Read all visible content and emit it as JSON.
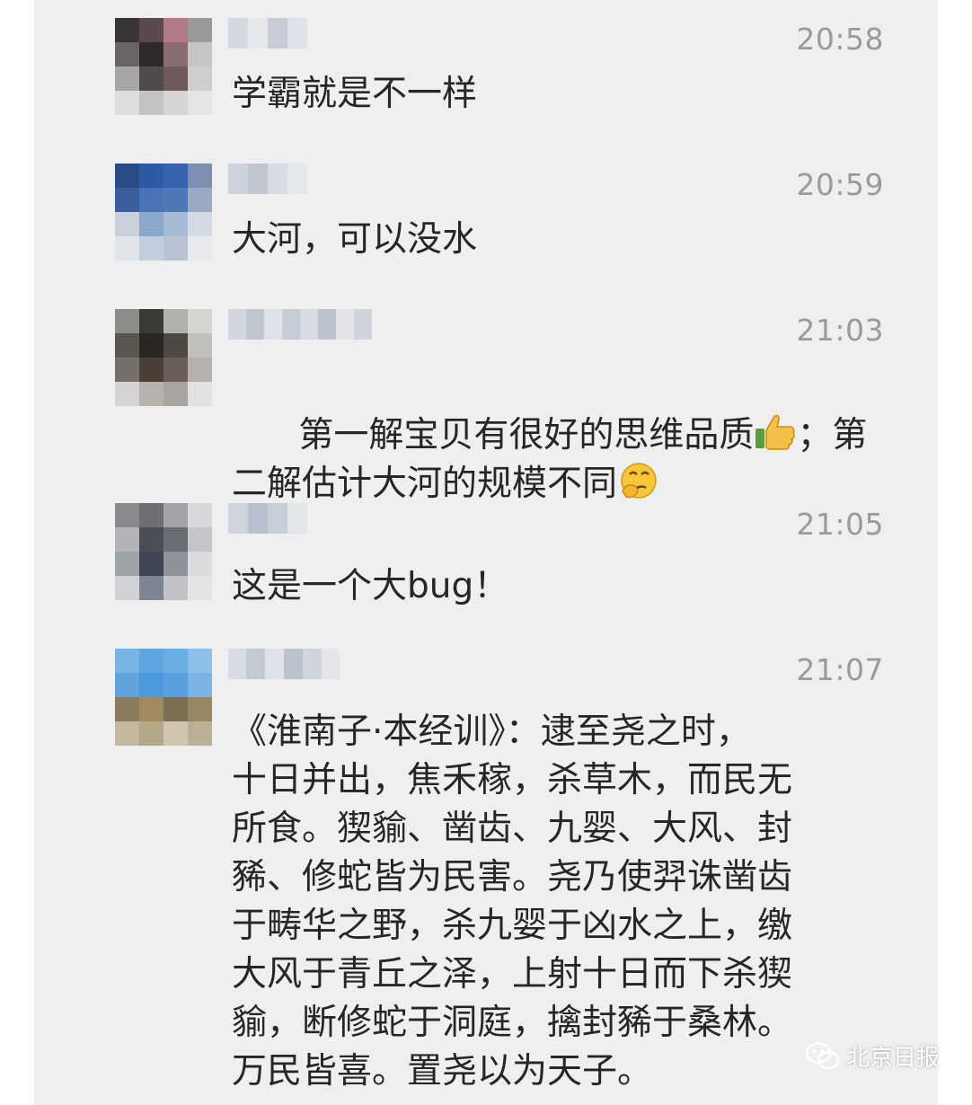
{
  "colors": {
    "panel_bg": "#efeff0",
    "text": "#262626",
    "timestamp": "#9a9a9a"
  },
  "messages": [
    {
      "time": "20:58",
      "text": "学霸就是不一样"
    },
    {
      "time": "20:59",
      "text": "大河，可以没水"
    },
    {
      "time": "21:03",
      "text_line1_a": "第一解宝贝有很好的思维品质",
      "text_line1_b": "；第",
      "text_line2": "二解估计大河的规模不同",
      "emoji1": "thumbs-up-icon",
      "emoji2": "thinking-face-icon"
    },
    {
      "time": "21:05",
      "text": "这是一个大bug！"
    },
    {
      "time": "21:07",
      "text": "《淮南子·本经训》：逮至尧之时，\n十日并出，焦禾稼，杀草木，而民无\n所食。猰貐、凿齿、九婴、大风、封\n豨、修蛇皆为民害。尧乃使羿诛凿齿\n于畴华之野，杀九婴于凶水之上，缴\n大风于青丘之泽，上射十日而下杀猰\n貐，断修蛇于洞庭，擒封豨于桑林。\n万民皆喜。置尧以为天子。"
    }
  ],
  "watermark": {
    "icon": "wechat-icon",
    "text": "北京日报"
  }
}
